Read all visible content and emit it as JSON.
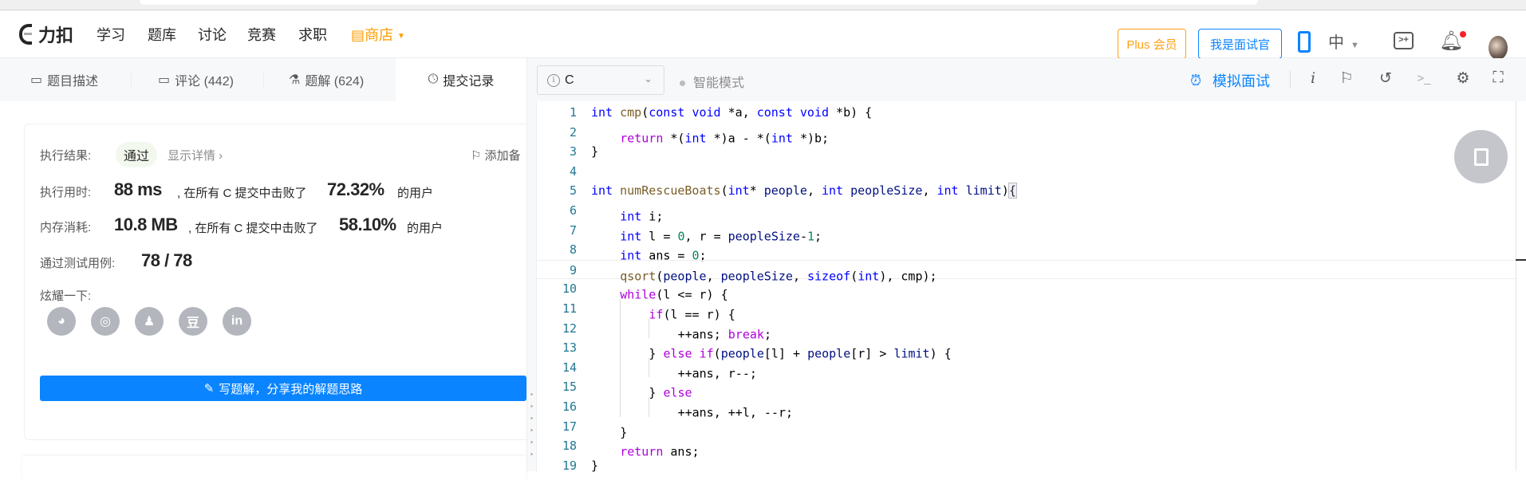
{
  "header": {
    "logo_text": "力扣",
    "nav": [
      "学习",
      "题库",
      "讨论",
      "竞赛",
      "求职"
    ],
    "shop_label": "商店",
    "plus_label": "Plus 会员",
    "interviewer_label": "我是面试官",
    "lang_label": "中"
  },
  "tabs": [
    {
      "label": "题目描述"
    },
    {
      "label": "评论 (442)"
    },
    {
      "label": "题解 (624)"
    },
    {
      "label": "提交记录"
    }
  ],
  "result": {
    "status_label": "执行结果:",
    "status": "通过",
    "details_link": "显示详情 ›",
    "add_note": "添加备",
    "runtime_label": "执行用时:",
    "runtime": "88 ms",
    "beat_text": ", 在所有 C 提交中击败了",
    "runtime_pct": "72.32%",
    "users_text": "的用户",
    "memory_label": "内存消耗:",
    "memory": "10.8 MB",
    "memory_pct": "58.10%",
    "tests_label": "通过测试用例:",
    "tests": "78 / 78",
    "share_label": "炫耀一下:",
    "share_icons": [
      "wechat-icon",
      "weibo-icon",
      "qq-icon",
      "douban-icon",
      "linkedin-icon"
    ],
    "write_solution": "写题解，分享我的解题思路"
  },
  "editor": {
    "language": "C",
    "smart_mode": "智能模式",
    "mock_interview": "模拟面试",
    "current_line": 9,
    "lines": [
      {
        "indent": 0,
        "tokens": [
          [
            "int",
            "kw"
          ],
          [
            " ",
            "pl"
          ],
          [
            "cmp",
            "fn"
          ],
          [
            "(",
            "pl"
          ],
          [
            "const",
            "kw"
          ],
          [
            " ",
            "pl"
          ],
          [
            "void",
            "kw"
          ],
          [
            " *a, ",
            "pl"
          ],
          [
            "const",
            "kw"
          ],
          [
            " ",
            "pl"
          ],
          [
            "void",
            "kw"
          ],
          [
            " *b) {",
            "pl"
          ]
        ]
      },
      {
        "indent": 1,
        "tokens": [
          [
            "return",
            "ctl"
          ],
          [
            " *(",
            "pl"
          ],
          [
            "int",
            "kw"
          ],
          [
            " *)a - *(",
            "pl"
          ],
          [
            "int",
            "kw"
          ],
          [
            " *)b;",
            "pl"
          ]
        ]
      },
      {
        "indent": 0,
        "tokens": [
          [
            "}",
            "pl"
          ]
        ]
      },
      {
        "indent": 0,
        "tokens": []
      },
      {
        "indent": 0,
        "tokens": [
          [
            "int",
            "kw"
          ],
          [
            " ",
            "pl"
          ],
          [
            "numRescueBoats",
            "fn"
          ],
          [
            "(",
            "pl"
          ],
          [
            "int",
            "kw"
          ],
          [
            "* ",
            "pl"
          ],
          [
            "people",
            "id"
          ],
          [
            ", ",
            "pl"
          ],
          [
            "int",
            "kw"
          ],
          [
            " ",
            "pl"
          ],
          [
            "peopleSize",
            "id"
          ],
          [
            ", ",
            "pl"
          ],
          [
            "int",
            "kw"
          ],
          [
            " ",
            "pl"
          ],
          [
            "limit",
            "id"
          ],
          [
            ")",
            "pl"
          ],
          [
            "{",
            "brk"
          ]
        ]
      },
      {
        "indent": 1,
        "tokens": [
          [
            "int",
            "kw"
          ],
          [
            " i;",
            "pl"
          ]
        ]
      },
      {
        "indent": 1,
        "tokens": [
          [
            "int",
            "kw"
          ],
          [
            " l = ",
            "pl"
          ],
          [
            "0",
            "num"
          ],
          [
            ", r = ",
            "pl"
          ],
          [
            "peopleSize",
            "id"
          ],
          [
            "-",
            "pl"
          ],
          [
            "1",
            "num"
          ],
          [
            ";",
            "pl"
          ]
        ]
      },
      {
        "indent": 1,
        "tokens": [
          [
            "int",
            "kw"
          ],
          [
            " ans = ",
            "pl"
          ],
          [
            "0",
            "num"
          ],
          [
            ";",
            "pl"
          ]
        ]
      },
      {
        "indent": 1,
        "tokens": [
          [
            "qsort",
            "fn"
          ],
          [
            "(",
            "pl"
          ],
          [
            "people",
            "id"
          ],
          [
            ", ",
            "pl"
          ],
          [
            "peopleSize",
            "id"
          ],
          [
            ", ",
            "pl"
          ],
          [
            "sizeof",
            "kw"
          ],
          [
            "(",
            "pl"
          ],
          [
            "int",
            "kw"
          ],
          [
            "), cmp);",
            "pl"
          ]
        ]
      },
      {
        "indent": 1,
        "tokens": [
          [
            "while",
            "ctl"
          ],
          [
            "(l <= r) {",
            "pl"
          ]
        ]
      },
      {
        "indent": 2,
        "tokens": [
          [
            "if",
            "ctl"
          ],
          [
            "(l == r) {",
            "pl"
          ]
        ]
      },
      {
        "indent": 3,
        "tokens": [
          [
            "++ans; ",
            "pl"
          ],
          [
            "break",
            "ctl"
          ],
          [
            ";",
            "pl"
          ]
        ]
      },
      {
        "indent": 2,
        "tokens": [
          [
            "} ",
            "pl"
          ],
          [
            "else",
            "ctl"
          ],
          [
            " ",
            "pl"
          ],
          [
            "if",
            "ctl"
          ],
          [
            "(",
            "pl"
          ],
          [
            "people",
            "id"
          ],
          [
            "[l] + ",
            "pl"
          ],
          [
            "people",
            "id"
          ],
          [
            "[r] > ",
            "pl"
          ],
          [
            "limit",
            "id"
          ],
          [
            ") {",
            "pl"
          ]
        ]
      },
      {
        "indent": 3,
        "tokens": [
          [
            "++ans, r--;",
            "pl"
          ]
        ]
      },
      {
        "indent": 2,
        "tokens": [
          [
            "} ",
            "pl"
          ],
          [
            "else",
            "ctl"
          ]
        ]
      },
      {
        "indent": 3,
        "tokens": [
          [
            "++ans, ++l, --r;",
            "pl"
          ]
        ]
      },
      {
        "indent": 1,
        "tokens": [
          [
            "}",
            "pl"
          ]
        ]
      },
      {
        "indent": 1,
        "tokens": [
          [
            "return",
            "ctl"
          ],
          [
            " ans;",
            "pl"
          ]
        ]
      },
      {
        "indent": 0,
        "tokens": [
          [
            "}",
            "pl"
          ]
        ]
      }
    ]
  },
  "colors": {
    "accent": "#0a84ff",
    "plus": "#ffa116",
    "shop": "#ff9c00"
  }
}
